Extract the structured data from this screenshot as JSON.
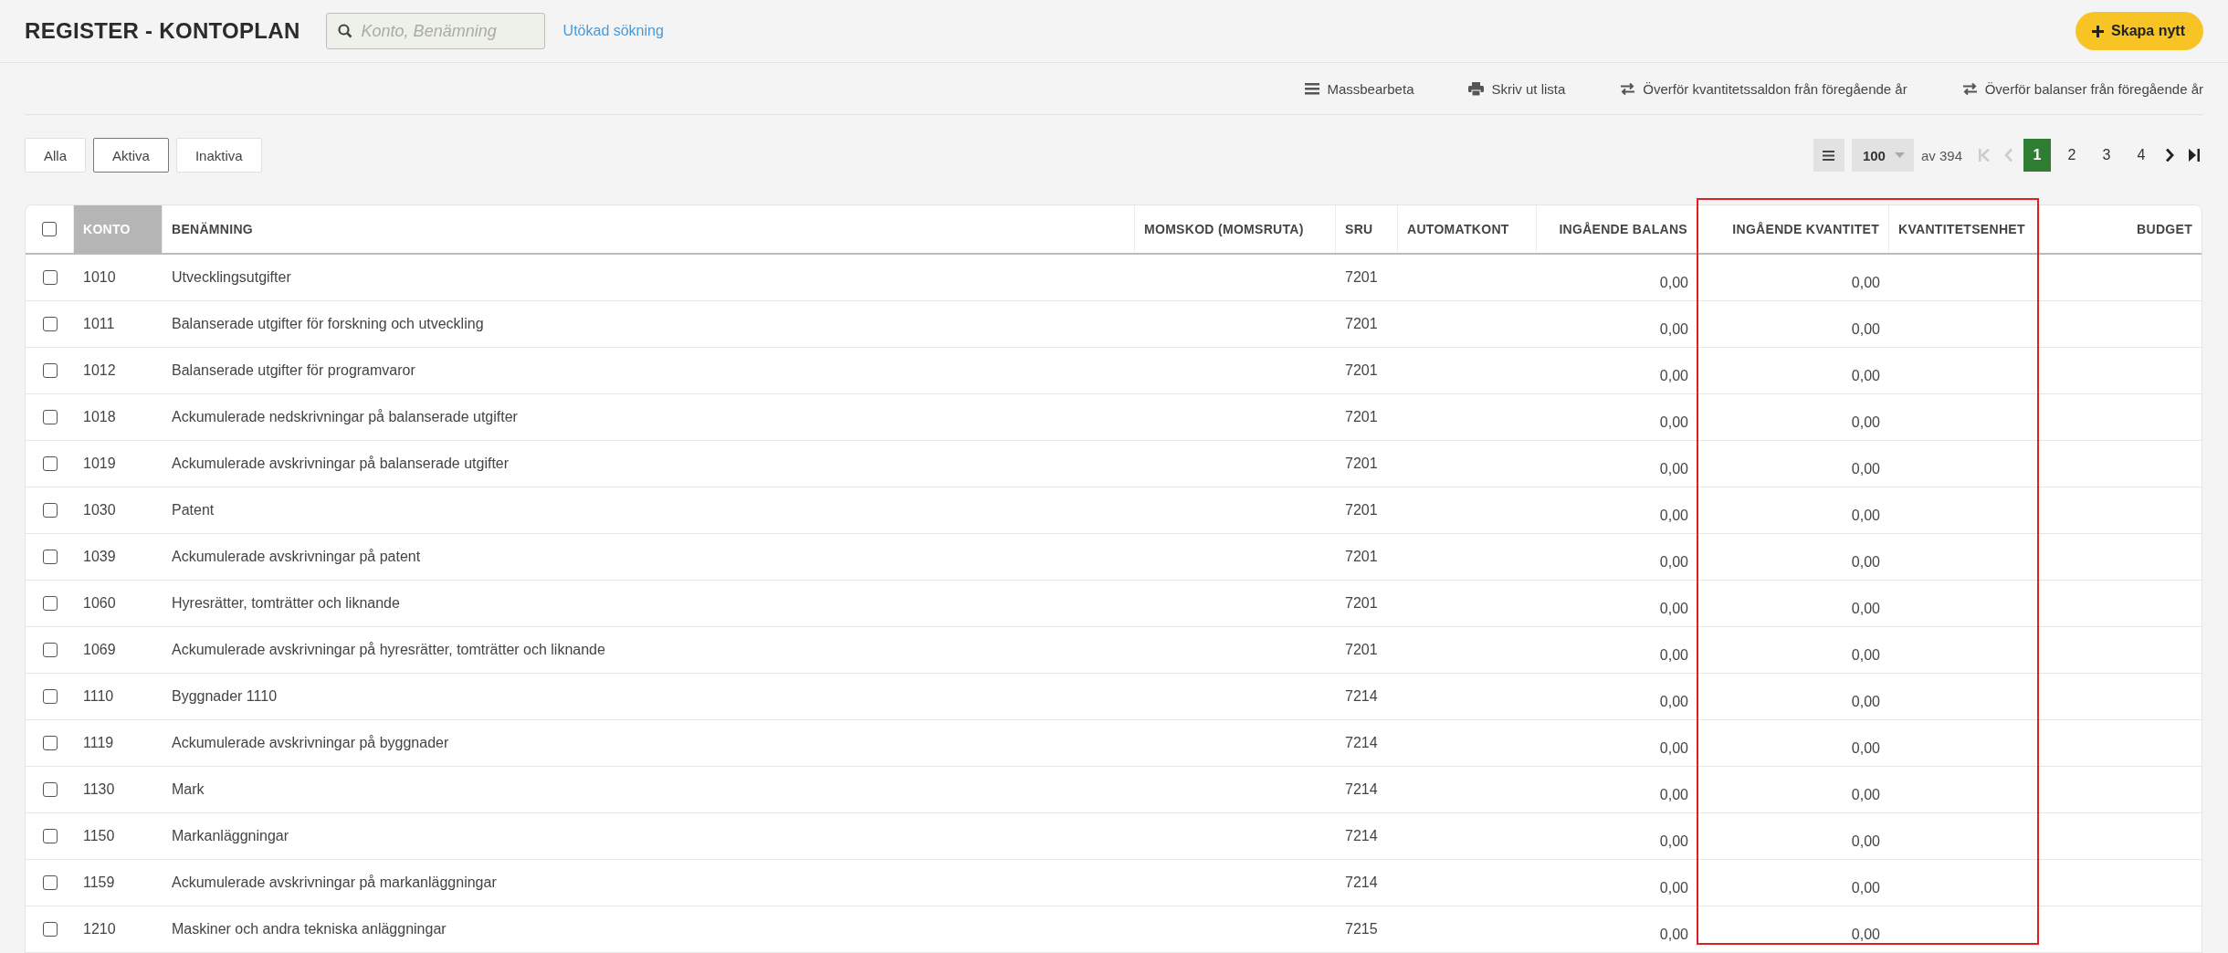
{
  "header": {
    "title": "REGISTER - KONTOPLAN",
    "search": {
      "placeholder": "Konto, Benämning"
    },
    "advanced_link": "Utökad sökning",
    "create_button": "Skapa nytt"
  },
  "toolbar": [
    {
      "kind": "menu",
      "label": "Massbearbeta"
    },
    {
      "kind": "print",
      "label": "Skriv ut lista"
    },
    {
      "kind": "transfer",
      "label": "Överför kvantitetssaldon från föregående år"
    },
    {
      "kind": "transfer",
      "label": "Överför balanser från föregående år"
    }
  ],
  "filters": [
    {
      "label": "Alla",
      "selected": false
    },
    {
      "label": "Aktiva",
      "selected": true
    },
    {
      "label": "Inaktiva",
      "selected": false
    }
  ],
  "pagination": {
    "per_page": "100",
    "total": "av 394",
    "first_disabled": true,
    "prev_disabled": true,
    "pages": [
      {
        "label": "1",
        "selected": true
      },
      {
        "label": "2",
        "selected": false
      },
      {
        "label": "3",
        "selected": false
      },
      {
        "label": "4",
        "selected": false
      }
    ]
  },
  "table": {
    "select_all_checked": false,
    "columns": [
      {
        "label": "KONTO",
        "sorted": true,
        "highlighted": false
      },
      {
        "label": "BENÄMNING",
        "sorted": false,
        "highlighted": false
      },
      {
        "label": "MOMSKOD (MOMSRUTA)",
        "sorted": false,
        "highlighted": false
      },
      {
        "label": "SRU",
        "sorted": false,
        "highlighted": false
      },
      {
        "label": "AUTOMATKONT",
        "sorted": false,
        "highlighted": false
      },
      {
        "label": "INGÅENDE BALANS",
        "sorted": false,
        "highlighted": false
      },
      {
        "label": "INGÅENDE KVANTITET",
        "sorted": false,
        "highlighted": true
      },
      {
        "label": "KVANTITETSENHET",
        "sorted": false,
        "highlighted": true
      },
      {
        "label": "BUDGET",
        "sorted": false,
        "highlighted": false
      }
    ],
    "rows": [
      {
        "checked": false,
        "konto": "1010",
        "name": "Utvecklingsutgifter",
        "sru": "7201",
        "balance": "0,00",
        "quantity": "0,00"
      },
      {
        "checked": false,
        "konto": "1011",
        "name": "Balanserade utgifter för forskning och utveckling",
        "sru": "7201",
        "balance": "0,00",
        "quantity": "0,00"
      },
      {
        "checked": false,
        "konto": "1012",
        "name": "Balanserade utgifter för programvaror",
        "sru": "7201",
        "balance": "0,00",
        "quantity": "0,00"
      },
      {
        "checked": false,
        "konto": "1018",
        "name": "Ackumulerade nedskrivningar på balanserade utgifter",
        "sru": "7201",
        "balance": "0,00",
        "quantity": "0,00"
      },
      {
        "checked": false,
        "konto": "1019",
        "name": "Ackumulerade avskrivningar på balanserade utgifter",
        "sru": "7201",
        "balance": "0,00",
        "quantity": "0,00"
      },
      {
        "checked": false,
        "konto": "1030",
        "name": "Patent",
        "sru": "7201",
        "balance": "0,00",
        "quantity": "0,00"
      },
      {
        "checked": false,
        "konto": "1039",
        "name": "Ackumulerade avskrivningar på patent",
        "sru": "7201",
        "balance": "0,00",
        "quantity": "0,00"
      },
      {
        "checked": false,
        "konto": "1060",
        "name": "Hyresrätter, tomträtter och liknande",
        "sru": "7201",
        "balance": "0,00",
        "quantity": "0,00"
      },
      {
        "checked": false,
        "konto": "1069",
        "name": "Ackumulerade avskrivningar på hyresrätter, tomträtter och liknande",
        "sru": "7201",
        "balance": "0,00",
        "quantity": "0,00"
      },
      {
        "checked": false,
        "konto": "1110",
        "name": "Byggnader 1110",
        "sru": "7214",
        "balance": "0,00",
        "quantity": "0,00"
      },
      {
        "checked": false,
        "konto": "1119",
        "name": "Ackumulerade avskrivningar på byggnader",
        "sru": "7214",
        "balance": "0,00",
        "quantity": "0,00"
      },
      {
        "checked": false,
        "konto": "1130",
        "name": "Mark",
        "sru": "7214",
        "balance": "0,00",
        "quantity": "0,00"
      },
      {
        "checked": false,
        "konto": "1150",
        "name": "Markanläggningar",
        "sru": "7214",
        "balance": "0,00",
        "quantity": "0,00"
      },
      {
        "checked": false,
        "konto": "1159",
        "name": "Ackumulerade avskrivningar på markanläggningar",
        "sru": "7214",
        "balance": "0,00",
        "quantity": "0,00"
      },
      {
        "checked": false,
        "konto": "1210",
        "name": "Maskiner och andra tekniska anläggningar",
        "sru": "7215",
        "balance": "0,00",
        "quantity": "0,00"
      }
    ]
  }
}
